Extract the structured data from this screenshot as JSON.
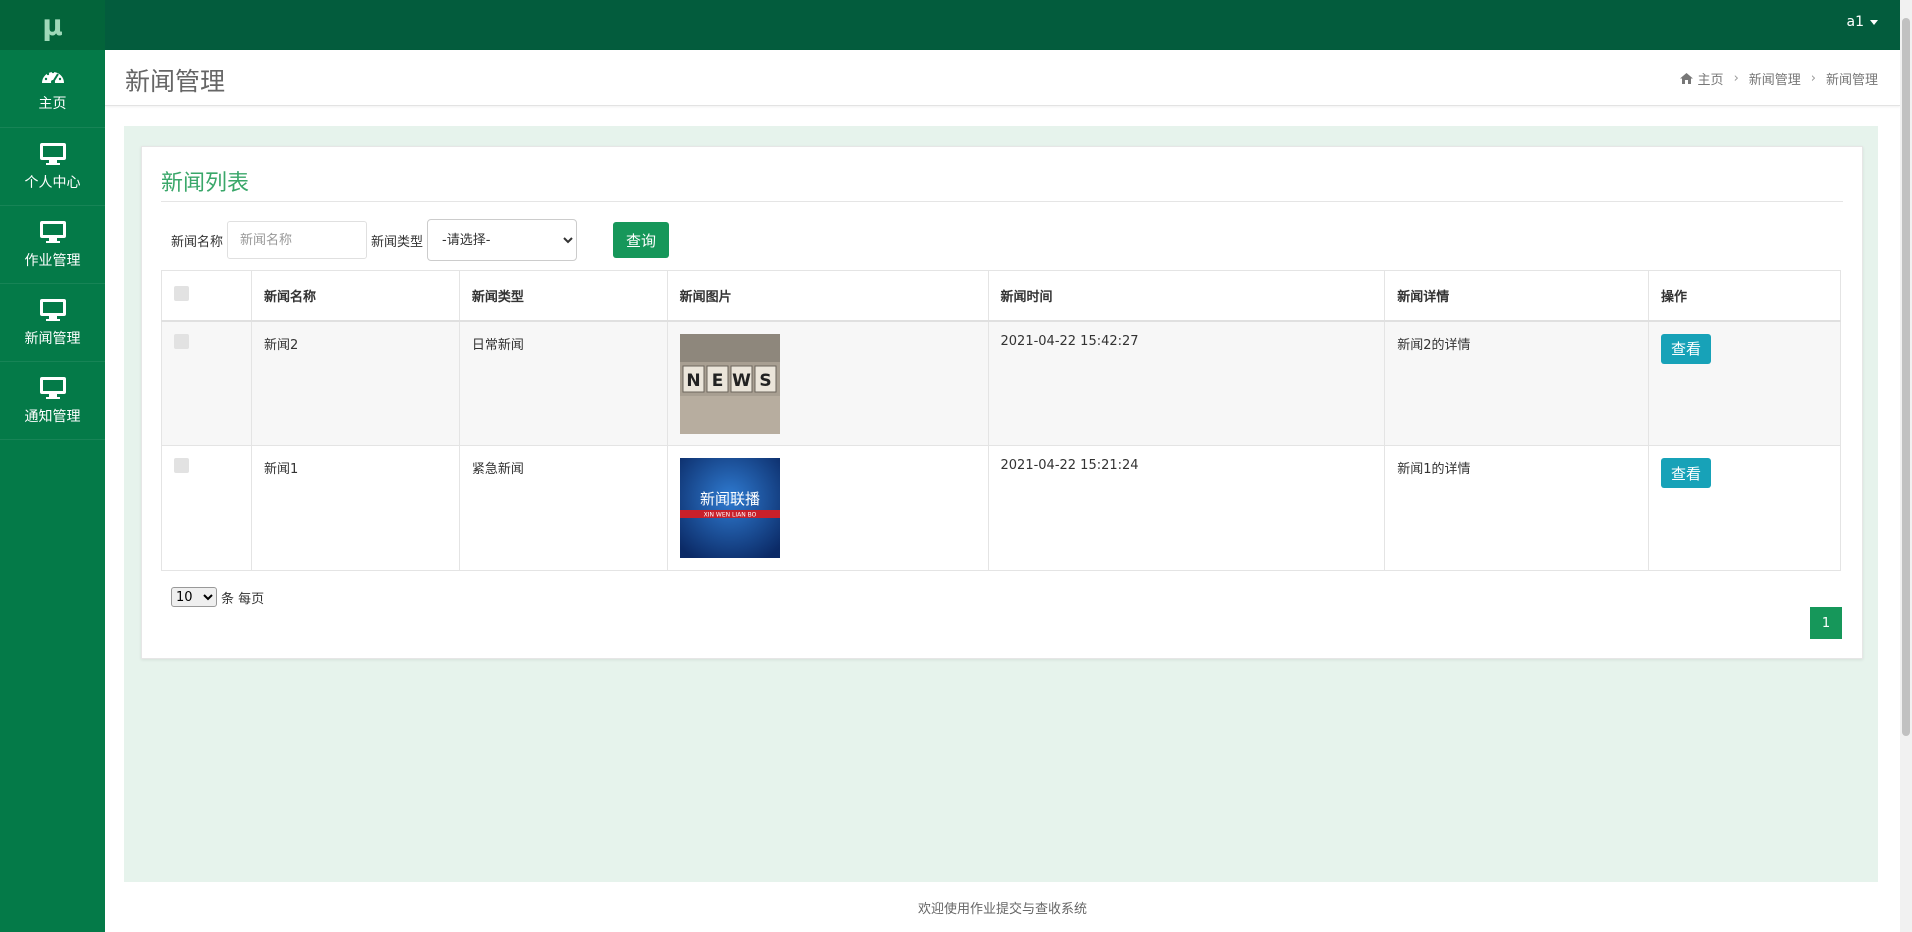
{
  "sidebar": {
    "logo": "μ",
    "items": [
      {
        "label": "主页",
        "icon": "dashboard-icon"
      },
      {
        "label": "个人中心",
        "icon": "monitor-icon"
      },
      {
        "label": "作业管理",
        "icon": "monitor-icon"
      },
      {
        "label": "新闻管理",
        "icon": "monitor-icon"
      },
      {
        "label": "通知管理",
        "icon": "monitor-icon"
      }
    ]
  },
  "topbar": {
    "user": "a1"
  },
  "header": {
    "title": "新闻管理",
    "breadcrumb": [
      "主页",
      "新闻管理",
      "新闻管理"
    ]
  },
  "panel": {
    "title": "新闻列表",
    "search": {
      "name_label": "新闻名称",
      "name_placeholder": "新闻名称",
      "type_label": "新闻类型",
      "type_selected": "-请选择-",
      "query_button": "查询"
    },
    "table": {
      "headers": [
        "新闻名称",
        "新闻类型",
        "新闻图片",
        "新闻时间",
        "新闻详情",
        "操作"
      ],
      "rows": [
        {
          "name": "新闻2",
          "type": "日常新闻",
          "image": "NEWS",
          "time": "2021-04-22 15:42:27",
          "detail": "新闻2的详情",
          "action": "查看"
        },
        {
          "name": "新闻1",
          "type": "紧急新闻",
          "image": "新闻联播",
          "image_sub": "XIN WEN LIAN BO",
          "time": "2021-04-22 15:21:24",
          "detail": "新闻1的详情",
          "action": "查看"
        }
      ]
    },
    "pagination": {
      "page_size": "10",
      "page_size_suffix": "条 每页",
      "current_page": "1"
    }
  },
  "footer": {
    "text": "欢迎使用作业提交与查收系统"
  },
  "colors": {
    "sidebar": "#047a48",
    "topbar": "#035c3d",
    "accent": "#16975a",
    "view_button": "#17a2b8",
    "content_bg": "#e6f3ec"
  }
}
